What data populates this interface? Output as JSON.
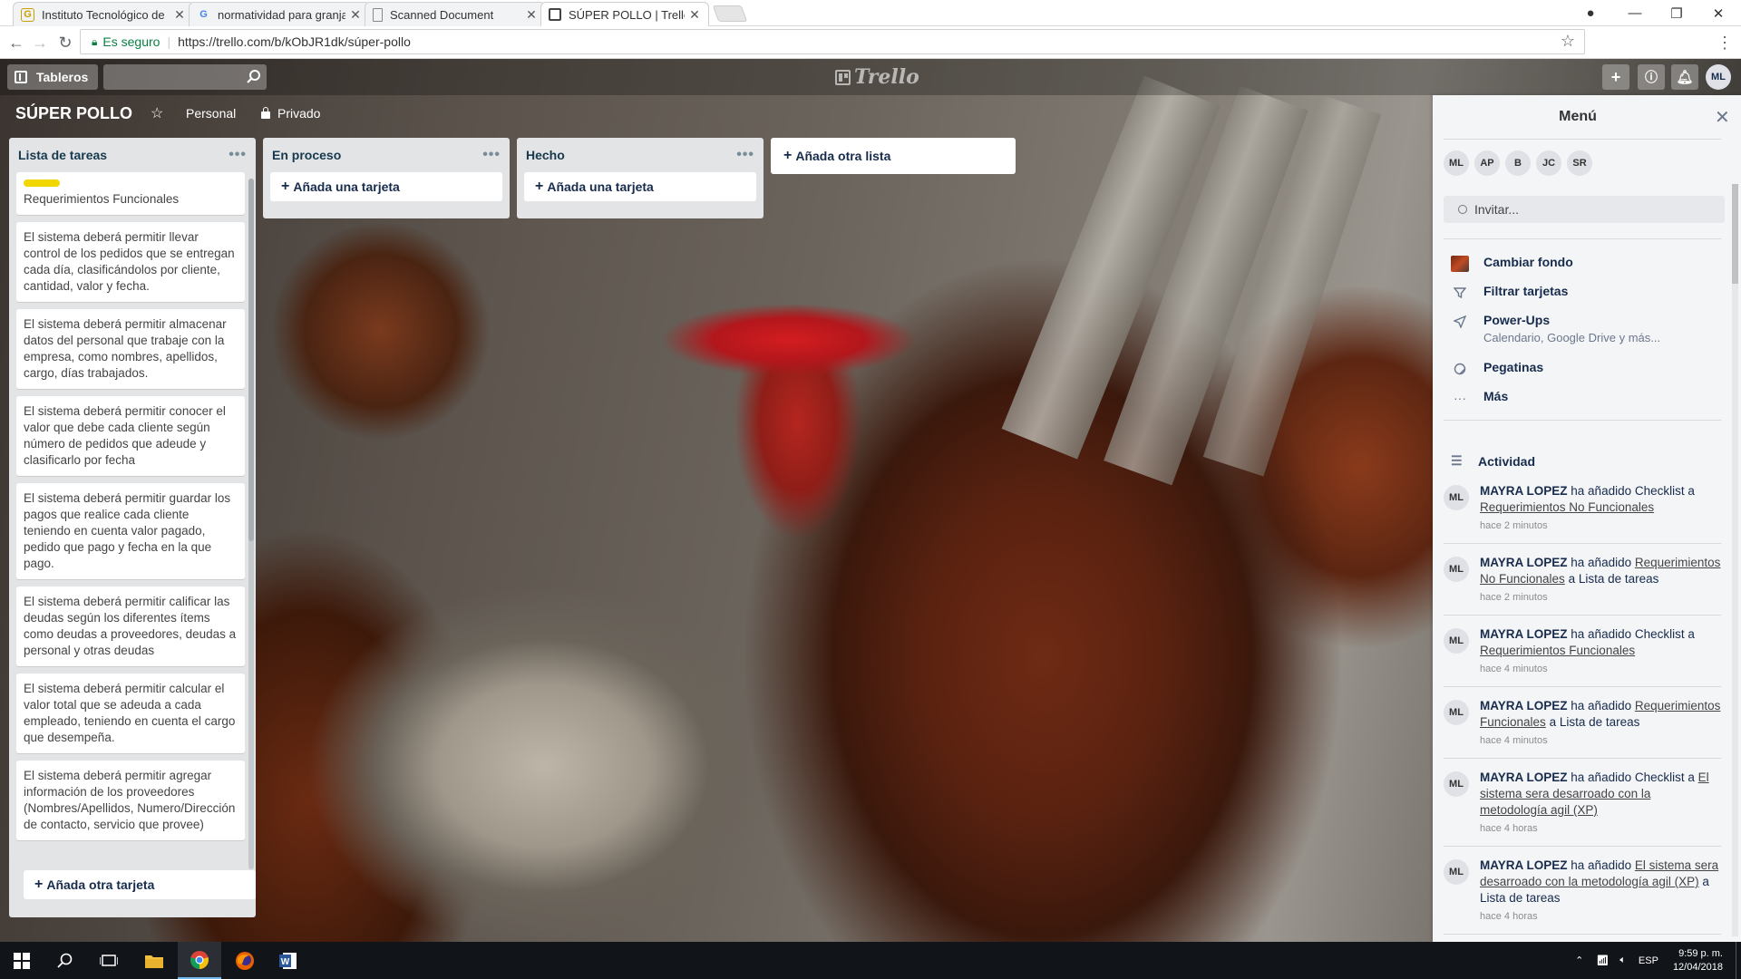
{
  "browser": {
    "tabs": [
      {
        "title": "Instituto Tecnológico de",
        "icon": "itc-favicon"
      },
      {
        "title": "normatividad para granja",
        "icon": "google-favicon"
      },
      {
        "title": "Scanned Document",
        "icon": "document-favicon"
      },
      {
        "title": "SÚPER POLLO | Trello",
        "icon": "trello-favicon",
        "active": true
      }
    ],
    "secure_label": "Es seguro",
    "url": "https://trello.com/b/kObJR1dk/súper-pollo"
  },
  "topbar": {
    "boards_label": "Tableros",
    "logo_text": "Trello",
    "user_initials": "ML"
  },
  "board": {
    "title": "SÚPER POLLO",
    "team": "Personal",
    "visibility": "Privado"
  },
  "lists": [
    {
      "name": "Lista de tareas",
      "cards": [
        {
          "text": "Requerimientos Funcionales",
          "label_color": "#f2d600"
        },
        {
          "text": "El sistema deberá permitir llevar control de los pedidos que se entregan cada día, clasificándolos por cliente, cantidad, valor y fecha."
        },
        {
          "text": "El sistema deberá permitir almacenar datos del personal que trabaje con la empresa, como nombres, apellidos, cargo, días trabajados."
        },
        {
          "text": "El sistema deberá permitir conocer el valor que debe cada cliente según número de pedidos que adeude y clasificarlo por fecha"
        },
        {
          "text": "El sistema deberá permitir guardar los pagos que realice cada cliente teniendo en cuenta valor pagado, pedido que pago y fecha en la que pago."
        },
        {
          "text": "El sistema deberá permitir calificar las deudas según los diferentes ítems como deudas a proveedores, deudas a personal y otras deudas"
        },
        {
          "text": "El sistema deberá permitir calcular el valor total que se adeuda a cada empleado, teniendo en cuenta el cargo que desempeña."
        },
        {
          "text": "El sistema deberá permitir agregar información de los proveedores (Nombres/Apellidos, Numero/Dirección de contacto, servicio que provee)"
        }
      ],
      "add_label": "Añada otra tarjeta"
    },
    {
      "name": "En proceso",
      "add_label": "Añada una tarjeta"
    },
    {
      "name": "Hecho",
      "add_label": "Añada una tarjeta"
    }
  ],
  "add_list_label": "Añada otra lista",
  "menu": {
    "title": "Menú",
    "members": [
      "ML",
      "AP",
      "B",
      "JC",
      "SR"
    ],
    "invite_label": "Invitar...",
    "items": [
      {
        "label": "Cambiar fondo",
        "icon": "background-thumbnail"
      },
      {
        "label": "Filtrar tarjetas",
        "icon": "filter-icon"
      },
      {
        "label": "Power-Ups",
        "sub": "Calendario, Google Drive y más...",
        "icon": "rocket-icon"
      },
      {
        "label": "Pegatinas",
        "icon": "sticker-icon"
      },
      {
        "label": "Más",
        "icon": "more-icon"
      }
    ],
    "activity_title": "Actividad",
    "activity": [
      {
        "user": "MAYRA LOPEZ",
        "before": "ha añadido Checklist a",
        "link": "Requerimientos No Funcionales",
        "after": "",
        "time": "hace 2 minutos"
      },
      {
        "user": "MAYRA LOPEZ",
        "before": "ha añadido",
        "link": "Requerimientos No Funcionales",
        "after": "a Lista de tareas",
        "time": "hace 2 minutos"
      },
      {
        "user": "MAYRA LOPEZ",
        "before": "ha añadido Checklist a",
        "link": "Requerimientos Funcionales",
        "after": "",
        "time": "hace 4 minutos"
      },
      {
        "user": "MAYRA LOPEZ",
        "before": "ha añadido",
        "link": "Requerimientos Funcionales",
        "after": "a Lista de tareas",
        "time": "hace 4 minutos"
      },
      {
        "user": "MAYRA LOPEZ",
        "before": "ha añadido Checklist a",
        "link": "El sistema sera desarroado con la metodología agil (XP)",
        "after": "",
        "time": "hace 4 horas"
      },
      {
        "user": "MAYRA LOPEZ",
        "before": "ha añadido",
        "link": "El sistema sera desarroado con la metodología agil (XP)",
        "after": "a Lista de tareas",
        "time": "hace 4 horas"
      }
    ]
  },
  "taskbar": {
    "language": "ESP",
    "time": "9:59 p. m.",
    "date": "12/04/2018"
  }
}
